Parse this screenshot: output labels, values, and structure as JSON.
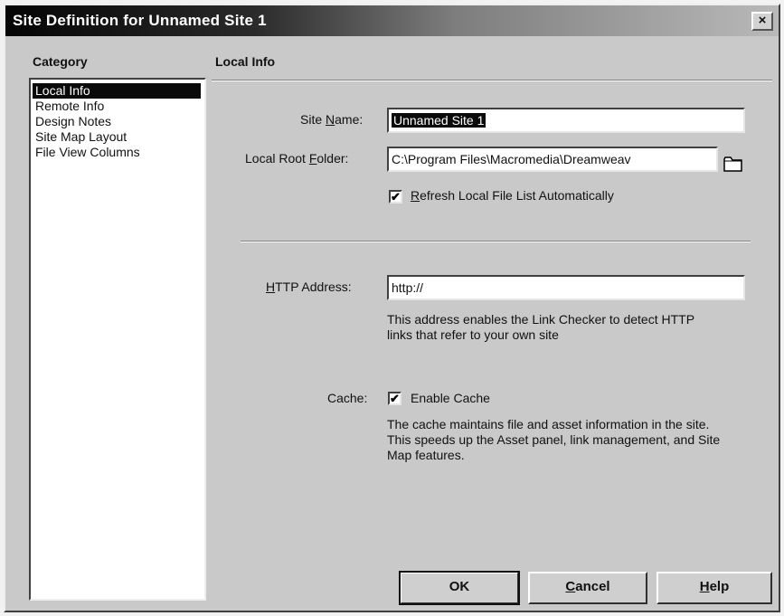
{
  "window": {
    "title": "Site Definition for Unnamed Site 1",
    "close_label": "×"
  },
  "category": {
    "header": "Category",
    "items": [
      {
        "label": "Local Info",
        "selected": true
      },
      {
        "label": "Remote Info",
        "selected": false
      },
      {
        "label": "Design Notes",
        "selected": false
      },
      {
        "label": "Site Map Layout",
        "selected": false
      },
      {
        "label": "File View Columns",
        "selected": false
      }
    ]
  },
  "panel": {
    "title": "Local Info",
    "site_name": {
      "label_pre": "Site ",
      "label_key": "N",
      "label_post": "ame:",
      "value": "Unnamed Site 1"
    },
    "local_root": {
      "label_pre": "Local Root ",
      "label_key": "F",
      "label_post": "older:",
      "value": "C:\\Program Files\\Macromedia\\Dreamweav",
      "folder_icon": "folder-icon"
    },
    "refresh": {
      "checked": true,
      "label_key": "R",
      "label_post": "efresh Local File List Automatically"
    },
    "http": {
      "label_key": "H",
      "label_post": "TTP Address:",
      "value": "http://",
      "help": "This address enables the Link Checker to detect HTTP links that refer to your own site"
    },
    "cache": {
      "label": "Cache:",
      "checked": true,
      "option_label": "Enable Cache",
      "help": "The cache maintains file and asset information in the site.  This speeds up the Asset panel, link management, and Site Map features."
    }
  },
  "buttons": {
    "ok": "OK",
    "cancel_key": "C",
    "cancel_post": "ancel",
    "help_key": "H",
    "help_post": "elp"
  },
  "check_mark": "✔"
}
